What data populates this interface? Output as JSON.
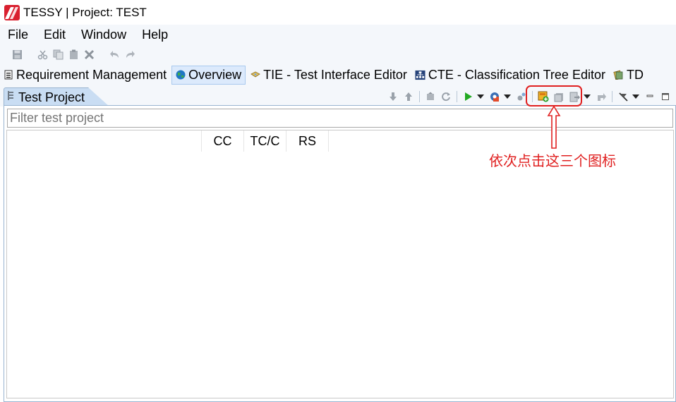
{
  "window": {
    "title": "TESSY | Project: TEST",
    "logo_icon": "tessy-logo-icon"
  },
  "menubar": {
    "items": [
      "File",
      "Edit",
      "Window",
      "Help"
    ]
  },
  "toolbar": {
    "icons": [
      "save-icon",
      "cut-icon",
      "copy-icon",
      "paste-icon",
      "delete-icon",
      "undo-icon",
      "redo-icon"
    ]
  },
  "perspectives": [
    {
      "label": "Requirement Management",
      "icon": "requirement-icon",
      "active": false
    },
    {
      "label": "Overview",
      "icon": "globe-icon",
      "active": true
    },
    {
      "label": "TIE - Test Interface Editor",
      "icon": "tie-icon",
      "active": false
    },
    {
      "label": "CTE - Classification Tree Editor",
      "icon": "cte-icon",
      "active": false
    },
    {
      "label": "TD",
      "icon": "td-icon",
      "active": false
    }
  ],
  "view": {
    "tab_label": "Test Project",
    "filter_placeholder": "Filter test project",
    "columns": [
      "CC",
      "TC/C",
      "RS"
    ]
  },
  "annotation": {
    "text": "依次点击这三个图标",
    "color": "#e02020"
  },
  "colors": {
    "accent": "#dceafc",
    "tab": "#c9ddf3",
    "annotation": "#e02020"
  }
}
